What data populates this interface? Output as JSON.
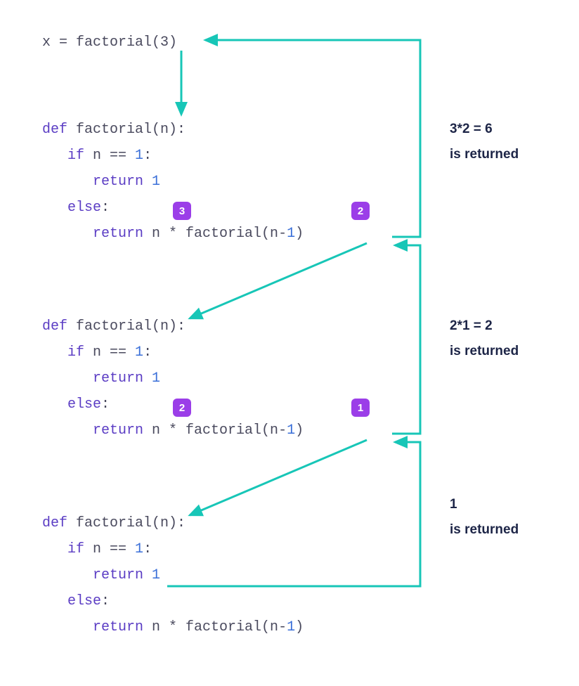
{
  "call": "x = factorial(3)",
  "function_blocks": [
    {
      "lines": [
        [
          {
            "t": "def",
            "c": "kw"
          },
          {
            "t": " factorial(n):",
            "c": "id"
          }
        ],
        [
          {
            "t": "   ",
            "c": "id"
          },
          {
            "t": "if",
            "c": "kw"
          },
          {
            "t": " n == ",
            "c": "id"
          },
          {
            "t": "1",
            "c": "num"
          },
          {
            "t": ":",
            "c": "id"
          }
        ],
        [
          {
            "t": "      ",
            "c": "id"
          },
          {
            "t": "return",
            "c": "kw"
          },
          {
            "t": " ",
            "c": "id"
          },
          {
            "t": "1",
            "c": "num"
          }
        ],
        [
          {
            "t": "   ",
            "c": "id"
          },
          {
            "t": "else",
            "c": "kw"
          },
          {
            "t": ":",
            "c": "id"
          }
        ],
        [
          {
            "t": "      ",
            "c": "id"
          },
          {
            "t": "return",
            "c": "kw"
          },
          {
            "t": " n * factorial(n-",
            "c": "id"
          },
          {
            "t": "1",
            "c": "num"
          },
          {
            "t": ")",
            "c": "id"
          }
        ]
      ]
    },
    {
      "lines": [
        [
          {
            "t": "def",
            "c": "kw"
          },
          {
            "t": " factorial(n):",
            "c": "id"
          }
        ],
        [
          {
            "t": "   ",
            "c": "id"
          },
          {
            "t": "if",
            "c": "kw"
          },
          {
            "t": " n == ",
            "c": "id"
          },
          {
            "t": "1",
            "c": "num"
          },
          {
            "t": ":",
            "c": "id"
          }
        ],
        [
          {
            "t": "      ",
            "c": "id"
          },
          {
            "t": "return",
            "c": "kw"
          },
          {
            "t": " ",
            "c": "id"
          },
          {
            "t": "1",
            "c": "num"
          }
        ],
        [
          {
            "t": "   ",
            "c": "id"
          },
          {
            "t": "else",
            "c": "kw"
          },
          {
            "t": ":",
            "c": "id"
          }
        ],
        [
          {
            "t": "      ",
            "c": "id"
          },
          {
            "t": "return",
            "c": "kw"
          },
          {
            "t": " n * factorial(n-",
            "c": "id"
          },
          {
            "t": "1",
            "c": "num"
          },
          {
            "t": ")",
            "c": "id"
          }
        ]
      ]
    },
    {
      "lines": [
        [
          {
            "t": "def",
            "c": "kw"
          },
          {
            "t": " factorial(n):",
            "c": "id"
          }
        ],
        [
          {
            "t": "   ",
            "c": "id"
          },
          {
            "t": "if",
            "c": "kw"
          },
          {
            "t": " n == ",
            "c": "id"
          },
          {
            "t": "1",
            "c": "num"
          },
          {
            "t": ":",
            "c": "id"
          }
        ],
        [
          {
            "t": "      ",
            "c": "id"
          },
          {
            "t": "return",
            "c": "kw"
          },
          {
            "t": " ",
            "c": "id"
          },
          {
            "t": "1",
            "c": "num"
          }
        ],
        [
          {
            "t": "   ",
            "c": "id"
          },
          {
            "t": "else",
            "c": "kw"
          },
          {
            "t": ":",
            "c": "id"
          }
        ],
        [
          {
            "t": "      ",
            "c": "id"
          },
          {
            "t": "return",
            "c": "kw"
          },
          {
            "t": " n * factorial(n-",
            "c": "id"
          },
          {
            "t": "1",
            "c": "num"
          },
          {
            "t": ")",
            "c": "id"
          }
        ]
      ]
    }
  ],
  "badges": {
    "block1_n": "3",
    "block1_arg": "2",
    "block2_n": "2",
    "block2_arg": "1"
  },
  "annotations": {
    "r1_line1": "3*2 = 6",
    "r1_line2": "is returned",
    "r2_line1": "2*1 = 2",
    "r2_line2": "is returned",
    "r3_line1": "1",
    "r3_line2": "is returned"
  },
  "colors": {
    "arrow": "#17c6b7",
    "badge": "#9b3ee8",
    "keyword": "#5b3dc4",
    "number": "#3a6fd8",
    "text": "#4a4a5e",
    "annotation": "#1d2547"
  }
}
